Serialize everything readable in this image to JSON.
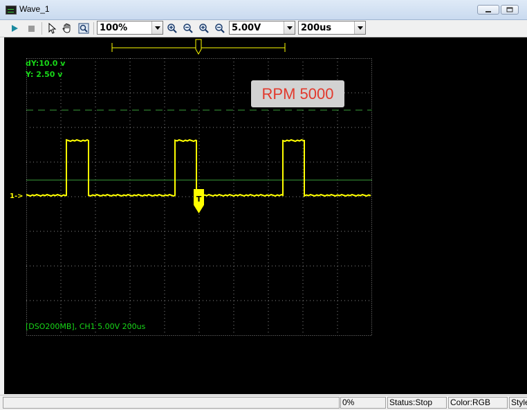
{
  "window": {
    "title": "Wave_1"
  },
  "toolbar": {
    "zoom_value": "100%",
    "volt_value": "5.00V",
    "time_value": "200us"
  },
  "scope": {
    "dy_label": "dY:10.0  v",
    "y_label": "Y:  2.50 v",
    "channel_marker": "1->",
    "trigger_label": "T",
    "footer": "[DSO200MB], CH1 5.00V 200us",
    "annotation": "RPM 5000",
    "colors": {
      "trace": "#ffff00",
      "grid": "#8a8a8a",
      "text": "#18d818",
      "annotation": "#e2392d"
    }
  },
  "statusbar": {
    "progress": "0%",
    "status": "Status:Stop",
    "color": "Color:RGB",
    "style": "Style"
  }
}
